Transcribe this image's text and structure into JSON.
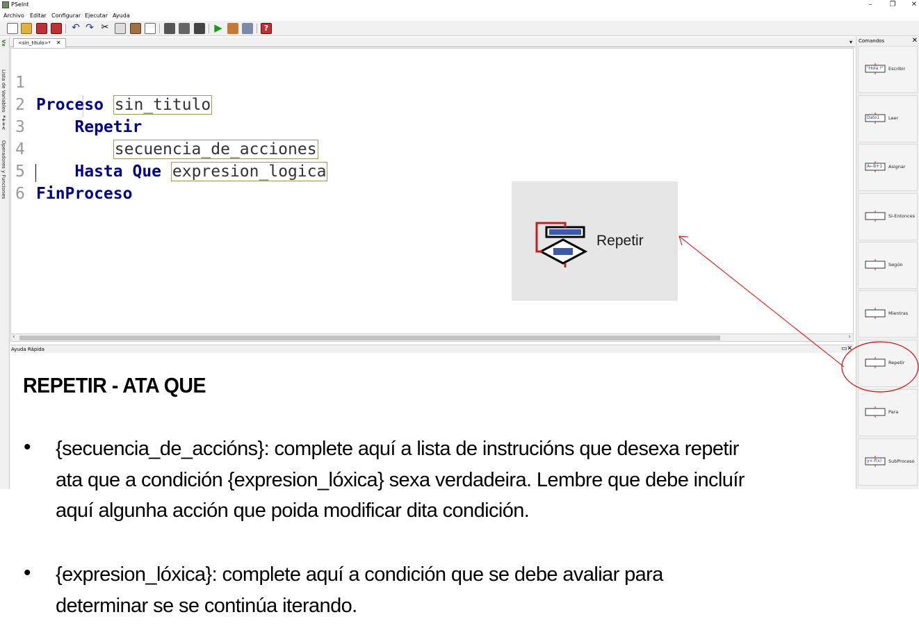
{
  "window": {
    "title": "PSeInt",
    "minimize": "–",
    "restore": "❐",
    "close": "✕"
  },
  "menu": [
    "Archivo",
    "Editar",
    "Configurar",
    "Ejecutar",
    "Ayuda"
  ],
  "left_panel": {
    "variables_label": "Lista de Variables",
    "operators_label": "Operadores y Funciones",
    "symbols": "*+=<"
  },
  "editor": {
    "tab_label": "<sin_titulo>*",
    "tab_close": "✕",
    "line_numbers": [
      "1",
      "2",
      "3",
      "4",
      "5",
      "6"
    ],
    "lines": {
      "l1_kw": "Proceso",
      "l1_ph": "sin_titulo",
      "l2_kw": "Repetir",
      "l3_ph": "secuencia_de_acciones",
      "l4_kw": "Hasta Que",
      "l4_ph": "expresion_logica",
      "l5_kw": "FinProceso"
    }
  },
  "preview": {
    "label": "Repetir"
  },
  "help": {
    "panel_title": "Ayuda Rápida"
  },
  "commands": {
    "title": "Comandos",
    "items": [
      {
        "label": "Escribir",
        "icon": "escribir-icon",
        "icon_text": "\"Hola !\""
      },
      {
        "label": "Leer",
        "icon": "leer-icon",
        "icon_text": "Dato1"
      },
      {
        "label": "Asignar",
        "icon": "asignar-icon",
        "icon_text": "A←B+1"
      },
      {
        "label": "Si-Entonces",
        "icon": "si-entonces-icon",
        "icon_text": ""
      },
      {
        "label": "Según",
        "icon": "segun-icon",
        "icon_text": ""
      },
      {
        "label": "Mientras",
        "icon": "mientras-icon",
        "icon_text": ""
      },
      {
        "label": "Repetir",
        "icon": "repetir-icon",
        "icon_text": ""
      },
      {
        "label": "Para",
        "icon": "para-icon",
        "icon_text": ""
      },
      {
        "label": "SubProceso",
        "icon": "subproceso-icon",
        "icon_text": "y<-f(x)"
      }
    ]
  },
  "overlay": {
    "heading": "REPETIR - ATA QUE",
    "bullet_symbol": "•",
    "bullet1_line1": "{secuencia_de_accións}: complete  aquí a lista de instrucións que desexa repetir",
    "bullet1_line2": "ata que a condición {expresion_lóxica} sexa verdadeira. Lembre que debe incluír",
    "bullet1_line3": "aquí algunha acción que poida modificar dita condición.",
    "bullet2_line1": "{expresion_lóxica}: complete aquí a condición que se debe avaliar para",
    "bullet2_line2": "determinar se se continúa iterando."
  },
  "colors": {
    "keyword": "#00008b",
    "annotation": "#e00000",
    "toolbar_bg": "#f0f0f0"
  }
}
